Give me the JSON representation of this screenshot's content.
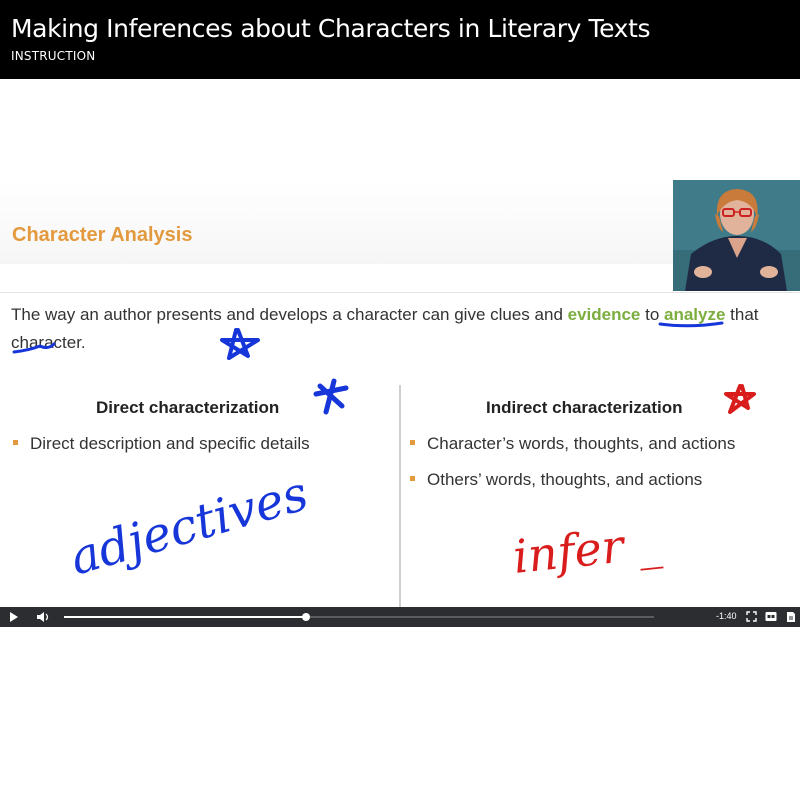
{
  "header": {
    "title": "Making Inferences about Characters in Literary Texts",
    "subtitle": "INSTRUCTION"
  },
  "slide": {
    "heading": "Character Analysis",
    "intro": {
      "part1": "The way an author presents and develops a character can give clues and ",
      "highlight1": "evidence",
      "part2": " to ",
      "highlight2": "analyze",
      "part3": " that character."
    },
    "left_column": {
      "title": "Direct characterization",
      "bullets": [
        "Direct description and specific details"
      ]
    },
    "right_column": {
      "title": "Indirect characterization",
      "bullets": [
        "Character’s words, thoughts, and actions",
        "Others’ words, thoughts, and actions"
      ]
    },
    "handwriting": {
      "left_word": "adjectives",
      "right_word": "infer _",
      "left_color": "#1636d9",
      "right_color": "#d91d1d"
    },
    "accent_color": "#e39a3f",
    "highlight_color": "#7cae3f"
  },
  "player": {
    "progress": 0.41,
    "time_remaining": "-1:40",
    "icons": [
      "play-icon",
      "volume-icon",
      "fullscreen-icon",
      "settings-icon",
      "captions-icon",
      "transcript-icon"
    ]
  }
}
